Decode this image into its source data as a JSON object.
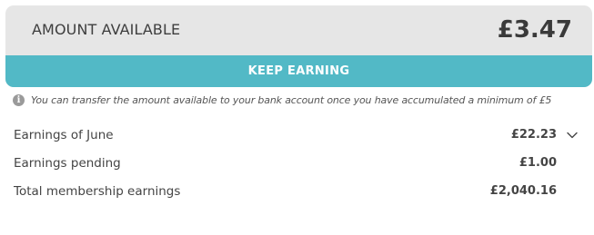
{
  "balance": {
    "label": "AMOUNT AVAILABLE",
    "amount": "£3.47"
  },
  "actions": {
    "keep_earning_label": "KEEP EARNING"
  },
  "notice": {
    "icon": "info-icon",
    "icon_glyph": "i",
    "text": "You can transfer the amount available to your bank account once you have accumulated a minimum of £5"
  },
  "earnings": [
    {
      "label": "Earnings of June",
      "value": "£22.23",
      "expandable": true
    },
    {
      "label": "Earnings pending",
      "value": "£1.00",
      "expandable": false
    },
    {
      "label": "Total membership earnings",
      "value": "£2,040.16",
      "expandable": false
    }
  ],
  "colors": {
    "accent": "#52b9c6",
    "card_background": "#e6e6e6",
    "text": "#3c3c3c"
  }
}
